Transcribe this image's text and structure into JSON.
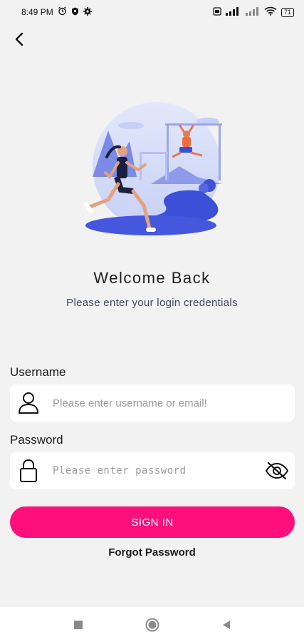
{
  "status_bar": {
    "time": "8:49 PM",
    "left_icons": [
      "alarm-icon",
      "shield-icon",
      "settings-icon"
    ],
    "right_icons": [
      "sim-icon",
      "signal-icon",
      "signal-icon",
      "wifi-icon"
    ],
    "battery": "71"
  },
  "header": {
    "back_icon": "chevron-left-icon"
  },
  "hero": {
    "illustration": "runner-and-gymnast-illustration"
  },
  "welcome": {
    "title": "Welcome Back",
    "subtitle": "Please enter your login credentials"
  },
  "form": {
    "username_label": "Username",
    "username_placeholder": "Please enter username or email!",
    "username_value": "",
    "password_label": "Password",
    "password_placeholder": "Please enter password",
    "password_value": "",
    "sign_in_label": "SIGN IN",
    "forgot_label": "Forgot Password"
  },
  "colors": {
    "accent": "#ff0f7b",
    "background": "#f2f2f3",
    "illustration_primary": "#5b6de0"
  },
  "nav_bar": {
    "buttons": [
      "recent-apps-icon",
      "home-icon",
      "back-icon"
    ]
  }
}
